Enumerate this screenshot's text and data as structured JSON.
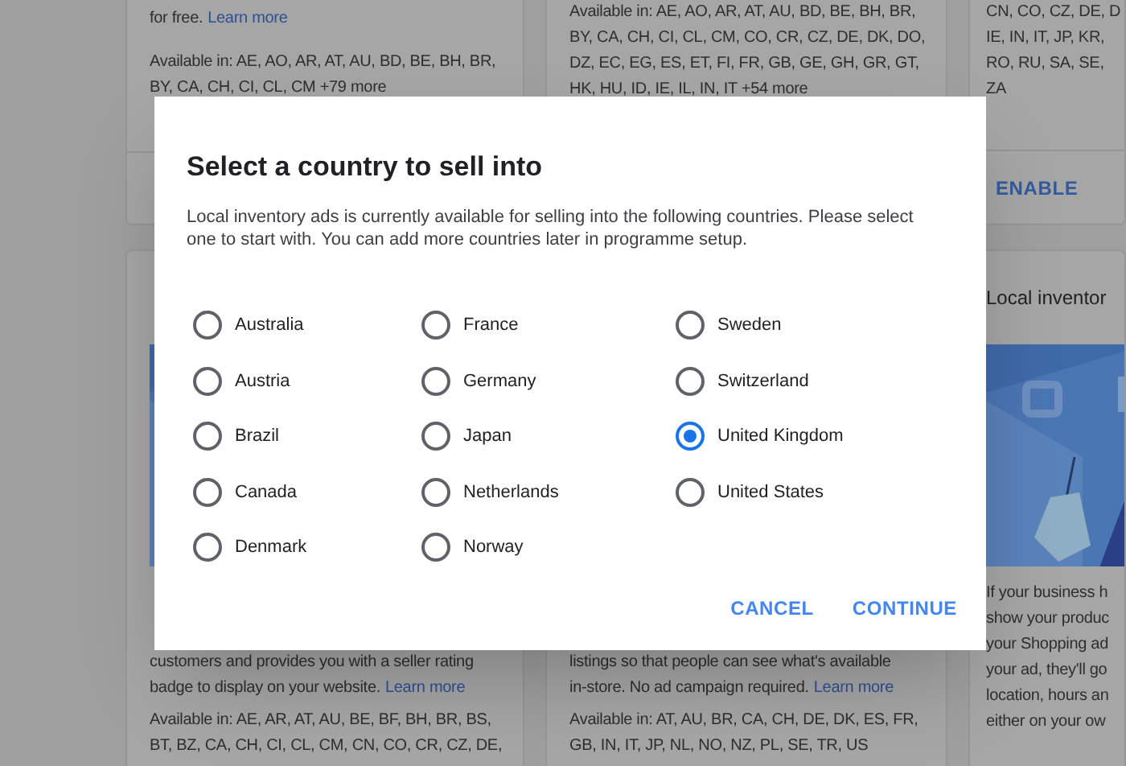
{
  "top_cards": [
    {
      "paragraphs": [
        [
          {
            "text": "for free.",
            "link": "Learn more"
          }
        ],
        [
          {
            "text": "Available in: AE, AO, AR, AT, AU, BD, BE, BH, BR,"
          },
          {
            "text": "BY, CA, CH, CI, CL, CM +79 more"
          }
        ]
      ]
    },
    {
      "paragraphs": [
        [
          {
            "text": "Available in: AE, AO, AR, AT, AU, BD, BE, BH, BR,"
          },
          {
            "text": "BY, CA, CH, CI, CL, CM, CO, CR, CZ, DE, DK, DO,"
          },
          {
            "text": "DZ, EC, EG, ES, ET, FI, FR, GB, GE, GH, GR, GT,"
          },
          {
            "text": "HK, HU, ID, IE, IL, IN, IT +54 more"
          }
        ]
      ]
    },
    {
      "paragraphs": [
        [
          {
            "text": "CN, CO, CZ, DE, D"
          },
          {
            "text": "IE, IN, IT, JP, KR,"
          },
          {
            "text": "RO, RU, SA, SE,"
          },
          {
            "text": "ZA"
          }
        ]
      ],
      "action": "ENABLE"
    }
  ],
  "bottom_cards": [
    {
      "picture": {
        "kind": "picture"
      },
      "paragraphs": [
        [
          {
            "text": "customers and provides you with a seller rating"
          },
          {
            "text": "badge to display on your website.",
            "link": "Learn more"
          }
        ],
        [
          {
            "text": "Available in: AE, AR, AT, AU, BE, BF, BH, BR, BS,"
          },
          {
            "text": "BT, BZ, CA, CH, CI, CL, CM, CN, CO, CR, CZ, DE,"
          }
        ]
      ]
    },
    {
      "paragraphs": [
        [
          {
            "text": "listings so that people can see what's available"
          },
          {
            "text": "in-store. No ad campaign required.",
            "link": "Learn more"
          }
        ],
        [
          {
            "text": "Available in: AT, AU, BR, CA, CH, DE, DK, ES, FR,"
          },
          {
            "text": "GB, IN, IT, JP, NL, NO, NZ, PL, SE, TR, US"
          }
        ]
      ]
    },
    {
      "title": "Local inventor",
      "picture": {
        "kind": "picture"
      },
      "paragraphs": [
        [
          {
            "text": "If your business h"
          },
          {
            "text": "show your produc"
          },
          {
            "text": "your Shopping ad"
          },
          {
            "text": "your ad, they'll go"
          },
          {
            "text": "location, hours an"
          },
          {
            "text": "either on your ow"
          }
        ]
      ]
    }
  ],
  "dialog": {
    "title": "Select a country to sell into",
    "description": "Local inventory ads is currently available for selling into the following countries. Please select one to start with. You can add more countries later in programme setup.",
    "countries": [
      {
        "label": "Australia",
        "selected": false
      },
      {
        "label": "Austria",
        "selected": false
      },
      {
        "label": "Brazil",
        "selected": false
      },
      {
        "label": "Canada",
        "selected": false
      },
      {
        "label": "Denmark",
        "selected": false
      },
      {
        "label": "France",
        "selected": false
      },
      {
        "label": "Germany",
        "selected": false
      },
      {
        "label": "Japan",
        "selected": false
      },
      {
        "label": "Netherlands",
        "selected": false
      },
      {
        "label": "Norway",
        "selected": false
      },
      {
        "label": "Sweden",
        "selected": false
      },
      {
        "label": "Switzerland",
        "selected": false
      },
      {
        "label": "United Kingdom",
        "selected": true
      },
      {
        "label": "United States",
        "selected": false
      }
    ],
    "buttons": [
      "CANCEL",
      "CONTINUE"
    ]
  }
}
